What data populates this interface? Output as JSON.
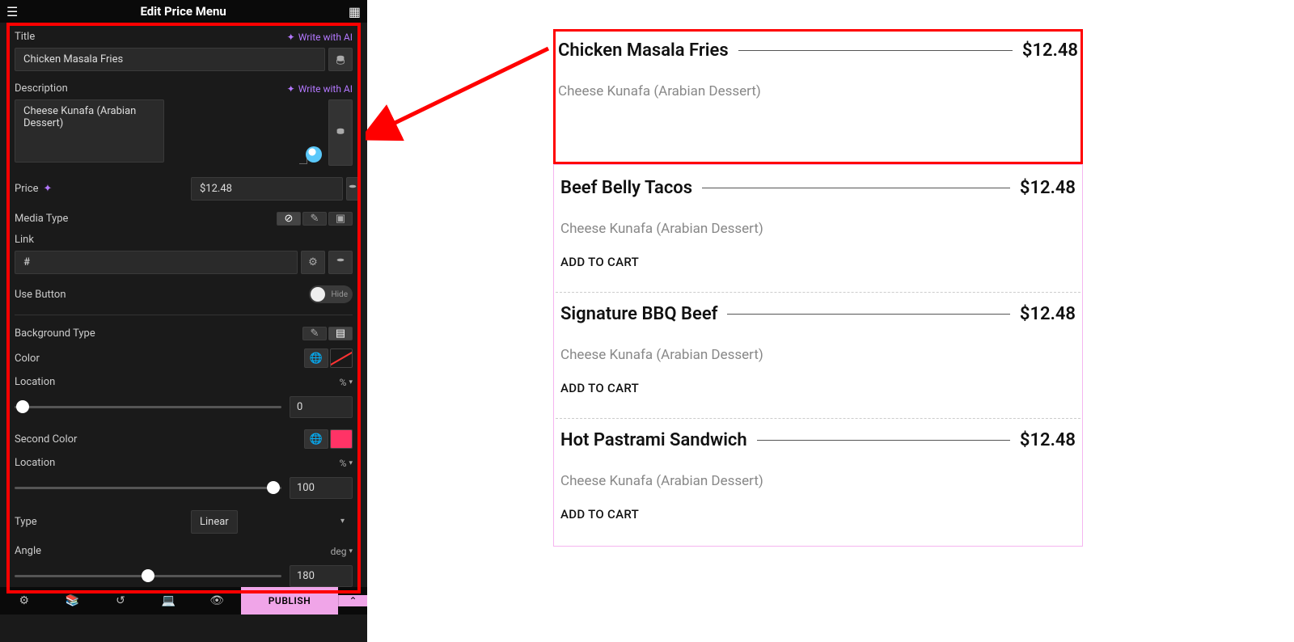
{
  "panel": {
    "title": "Edit Price Menu",
    "title_label": "Title",
    "ai_link": "Write with AI",
    "title_value": "Chicken Masala Fries",
    "description_label": "Description",
    "description_value": "Cheese Kunafa (Arabian Dessert)",
    "price_label": "Price",
    "price_value": "$12.48",
    "media_type_label": "Media Type",
    "link_label": "Link",
    "link_value": "#",
    "use_button_label": "Use Button",
    "hide_text": "Hide",
    "background_type_label": "Background Type",
    "color_label": "Color",
    "location_label": "Location",
    "location_unit": "%",
    "location_value": "0",
    "second_color_label": "Second Color",
    "location2_value": "100",
    "type_label": "Type",
    "type_value": "Linear",
    "angle_label": "Angle",
    "angle_unit": "deg",
    "angle_value": "180",
    "publish": "PUBLISH"
  },
  "menu": {
    "items": [
      {
        "title": "Chicken Masala Fries",
        "price": "$12.48",
        "desc": "Cheese Kunafa (Arabian Dessert)",
        "cart": "",
        "selected": true
      },
      {
        "title": "Beef Belly Tacos",
        "price": "$12.48",
        "desc": "Cheese Kunafa (Arabian Dessert)",
        "cart": "ADD TO CART",
        "selected": false
      },
      {
        "title": "Signature BBQ Beef",
        "price": "$12.48",
        "desc": "Cheese Kunafa (Arabian Dessert)",
        "cart": "ADD TO CART",
        "selected": false
      },
      {
        "title": "Hot Pastrami Sandwich",
        "price": "$12.48",
        "desc": "Cheese Kunafa (Arabian Dessert)",
        "cart": "ADD TO CART",
        "selected": false
      }
    ]
  },
  "icons": {
    "db": "🗄",
    "gear": "⚙",
    "layers": "≣",
    "history": "↺",
    "device": "▭",
    "eye": "👁"
  }
}
